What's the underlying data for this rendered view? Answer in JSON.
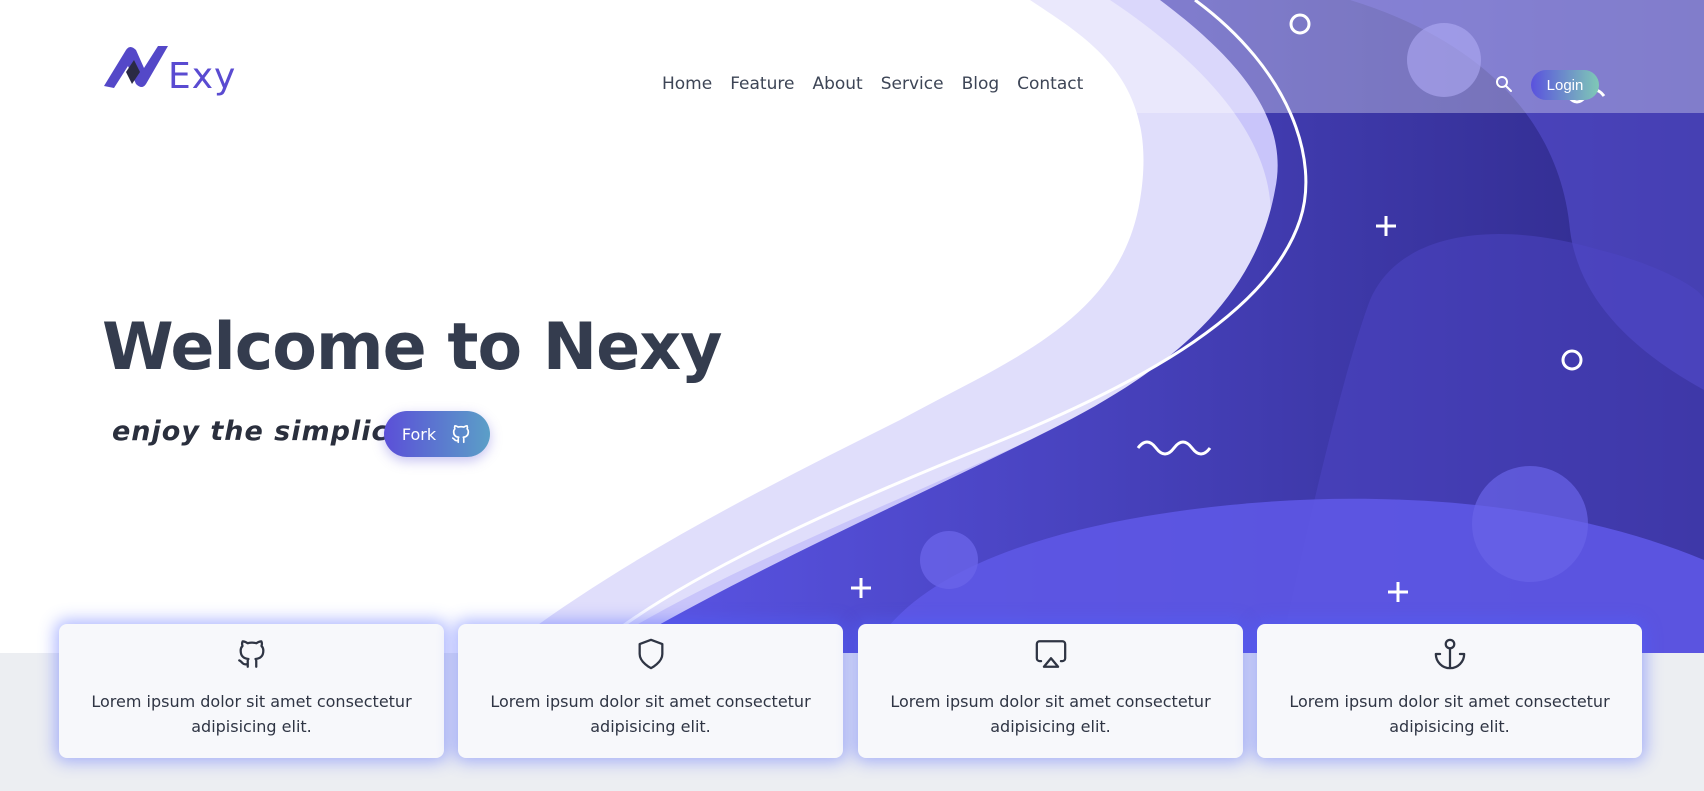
{
  "brand": {
    "logo_text": "Exy"
  },
  "nav": {
    "items": [
      {
        "label": "Home"
      },
      {
        "label": "Feature"
      },
      {
        "label": "About"
      },
      {
        "label": "Service"
      },
      {
        "label": "Blog"
      },
      {
        "label": "Contact"
      }
    ],
    "search_icon": "search-icon",
    "login_label": "Login"
  },
  "hero": {
    "title": "Welcome to Nexy",
    "tagline": "enjoy the simplicity",
    "fork_label": "Fork",
    "fork_icon": "github-icon"
  },
  "features": [
    {
      "icon": "github-icon",
      "text": "Lorem ipsum dolor sit amet consectetur adipisicing elit."
    },
    {
      "icon": "shield-icon",
      "text": "Lorem ipsum dolor sit amet consectetur adipisicing elit."
    },
    {
      "icon": "airplay-icon",
      "text": "Lorem ipsum dolor sit amet consectetur adipisicing elit."
    },
    {
      "icon": "anchor-icon",
      "text": "Lorem ipsum dolor sit amet consectetur adipisicing elit."
    }
  ],
  "colors": {
    "accent": "#4a3fcc",
    "accent_light": "#e2e0fb",
    "heading": "#343c4e",
    "login_gradient": [
      "#5a52de",
      "#7fc9b6"
    ],
    "fork_gradient": [
      "#5b4fd8",
      "#5b9fc7"
    ]
  }
}
